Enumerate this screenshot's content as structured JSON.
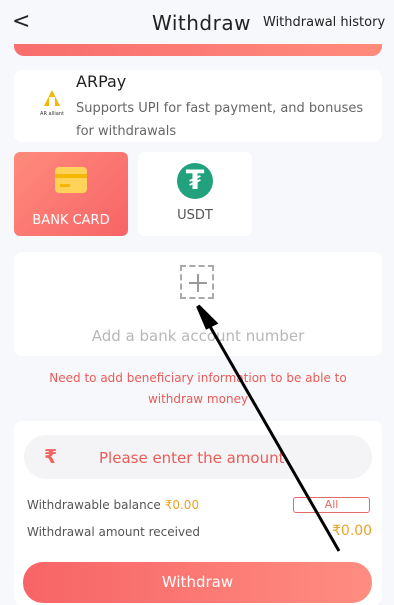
{
  "header": {
    "back_label": "<",
    "title": "Withdraw",
    "history_label": "Withdrawal history"
  },
  "payment_provider": {
    "name": "ARPay",
    "description": "Supports UPI for fast payment, and bonuses for withdrawals",
    "logo_text": "AR alliant"
  },
  "payment_methods": [
    {
      "label": "BANK CARD",
      "icon": "bank-card-icon",
      "selected": true
    },
    {
      "label": "USDT",
      "icon": "tether-icon",
      "selected": false
    }
  ],
  "bank_account": {
    "add_label": "Add a bank account number"
  },
  "warning_text": "Need to add beneficiary information to be able to withdraw money",
  "amount": {
    "currency_symbol": "₹",
    "placeholder": "Please enter the amount"
  },
  "balance": {
    "withdrawable_label": "Withdrawable balance",
    "withdrawable_value": "₹0.00",
    "all_button": "All",
    "received_label": "Withdrawal amount received",
    "received_value": "₹0.00"
  },
  "withdraw_button": "Withdraw",
  "colors": {
    "accent": "#f76467",
    "accent_light": "#ff8b7c",
    "amount": "#e8a325",
    "tether": "#22a17d",
    "card": "#ffd35a"
  }
}
